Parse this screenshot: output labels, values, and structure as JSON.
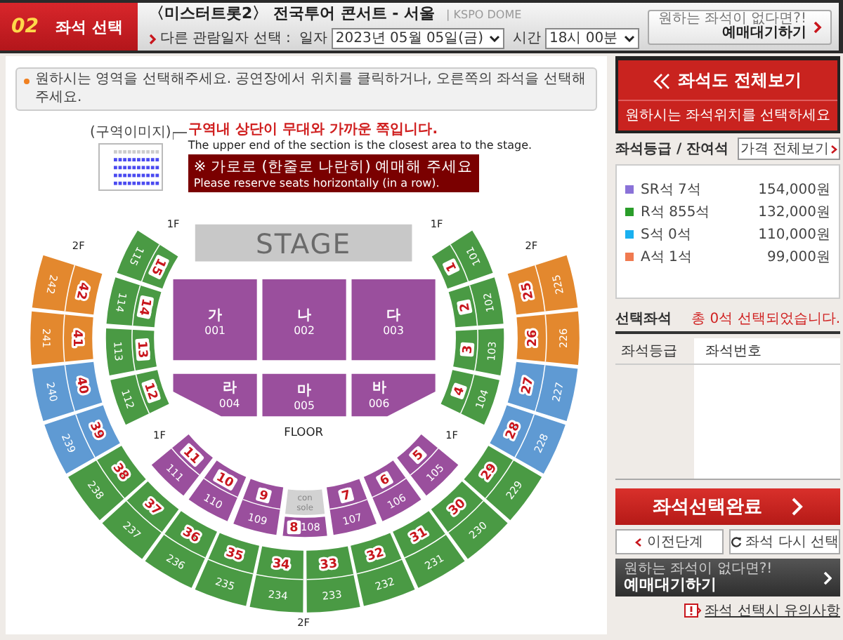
{
  "header": {
    "step": "02",
    "step_title": "좌석 선택",
    "title": "〈미스터트롯2〉 전국투어 콘서트 - 서울",
    "venue": "| KSPO DOME",
    "date_prompt": "다른 관람일자 선택 :",
    "date_label": "일자",
    "date_value": "2023년 05월 05일(금)",
    "time_label": "시간",
    "time_value": "18시 00분",
    "wait_hint": "원하는 좌석이 없다면?!",
    "wait_button": "예매대기하기"
  },
  "notice": "원하시는 영역을 선택해주세요. 공연장에서 위치를 클릭하거나, 오른쪽의 좌석을 선택해주세요.",
  "guide": {
    "image_caption": "(구역이미지)",
    "heading": "구역내 상단이 무대와 가까운 쪽입니다.",
    "heading_en": "The upper end of the section is the closest area to the stage.",
    "warning": "※ 가로로 (한줄로 나란히) 예매해 주세요",
    "warning_en": "Please reserve seats horizontally (in a row)."
  },
  "map": {
    "stage": "STAGE",
    "floor_label": "FLOOR",
    "console_lines": [
      "con",
      "sole"
    ],
    "level_labels": [
      "1F",
      "1F",
      "2F",
      "2F",
      "1F",
      "1F",
      "2F"
    ],
    "floor_blocks": [
      {
        "name": "가",
        "code": "001"
      },
      {
        "name": "나",
        "code": "002"
      },
      {
        "name": "다",
        "code": "003"
      },
      {
        "name": "라",
        "code": "004"
      },
      {
        "name": "마",
        "code": "005"
      },
      {
        "name": "바",
        "code": "006"
      }
    ],
    "sections_1f": [
      {
        "block": "15",
        "code": "115",
        "color": "#4a9a44",
        "kind": "standard"
      },
      {
        "block": "14",
        "code": "114",
        "color": "#4a9a44",
        "kind": "standard"
      },
      {
        "block": "13",
        "code": "113",
        "color": "#4a9a44",
        "kind": "standard"
      },
      {
        "block": "12",
        "code": "112",
        "color": "#4a9a44",
        "kind": "standard"
      },
      {
        "block": "11",
        "code": "111",
        "color": "#9a4f9d",
        "kind": "standard"
      },
      {
        "block": "10",
        "code": "110",
        "color": "#9a4f9d",
        "kind": "standard"
      },
      {
        "block": "9",
        "code": "109",
        "color": "#9a4f9d",
        "kind": "standard"
      },
      {
        "block": "8",
        "code": "108",
        "color": "#9a4f9d",
        "kind": "console"
      },
      {
        "block": "7",
        "code": "107",
        "color": "#9a4f9d",
        "kind": "standard"
      },
      {
        "block": "6",
        "code": "106",
        "color": "#9a4f9d",
        "kind": "standard"
      },
      {
        "block": "5",
        "code": "105",
        "color": "#9a4f9d",
        "kind": "standard"
      },
      {
        "block": "4",
        "code": "104",
        "color": "#4a9a44",
        "kind": "standard"
      },
      {
        "block": "3",
        "code": "103",
        "color": "#4a9a44",
        "kind": "standard"
      },
      {
        "block": "2",
        "code": "102",
        "color": "#4a9a44",
        "kind": "standard"
      },
      {
        "block": "1",
        "code": "101",
        "color": "#4a9a44",
        "kind": "standard"
      }
    ],
    "sections_2f": [
      {
        "block": "42",
        "code": "242",
        "color": "#e3882e"
      },
      {
        "block": "41",
        "code": "241",
        "color": "#e3882e"
      },
      {
        "block": "40",
        "code": "240",
        "color": "#5f9ad3"
      },
      {
        "block": "39",
        "code": "239",
        "color": "#5f9ad3"
      },
      {
        "block": "38",
        "code": "238",
        "color": "#4a9a44"
      },
      {
        "block": "37",
        "code": "237",
        "color": "#4a9a44"
      },
      {
        "block": "36",
        "code": "236",
        "color": "#4a9a44"
      },
      {
        "block": "35",
        "code": "235",
        "color": "#4a9a44"
      },
      {
        "block": "34",
        "code": "234",
        "color": "#4a9a44"
      },
      {
        "block": "33",
        "code": "233",
        "color": "#4a9a44"
      },
      {
        "block": "32",
        "code": "232",
        "color": "#4a9a44"
      },
      {
        "block": "31",
        "code": "231",
        "color": "#4a9a44"
      },
      {
        "block": "30",
        "code": "230",
        "color": "#4a9a44"
      },
      {
        "block": "29",
        "code": "229",
        "color": "#4a9a44"
      },
      {
        "block": "28",
        "code": "228",
        "color": "#5f9ad3"
      },
      {
        "block": "27",
        "code": "227",
        "color": "#5f9ad3"
      },
      {
        "block": "26",
        "code": "226",
        "color": "#e3882e"
      },
      {
        "block": "25",
        "code": "225",
        "color": "#e3882e"
      }
    ]
  },
  "side_panel": {
    "view_all": "좌석도 전체보기",
    "view_hint": "원하시는 좌석위치를 선택하세요",
    "grades_title": "좌석등급 / 잔여석",
    "price_button": "가격 전체보기",
    "grades": [
      {
        "name": "SR석 7석",
        "price": "154,000원",
        "color": "#8a72d8"
      },
      {
        "name": "R석 855석",
        "price": "132,000원",
        "color": "#2a9d2a"
      },
      {
        "name": "S석 0석",
        "price": "110,000원",
        "color": "#1ab0f0"
      },
      {
        "name": "A석 1석",
        "price": "99,000원",
        "color": "#f07a50"
      }
    ],
    "selected_title": "선택좌석",
    "selected_count": "총 0석 선택되었습니다.",
    "columns": [
      "좌석등급",
      "좌석번호"
    ],
    "complete_button": "좌석선택완료",
    "prev_button": "이전단계",
    "reset_button": "좌석 다시 선택",
    "wait_hint": "원하는 좌석이 없다면?!",
    "wait_button": "예매대기하기",
    "caution_link": "좌석 선택시 유의사항"
  }
}
